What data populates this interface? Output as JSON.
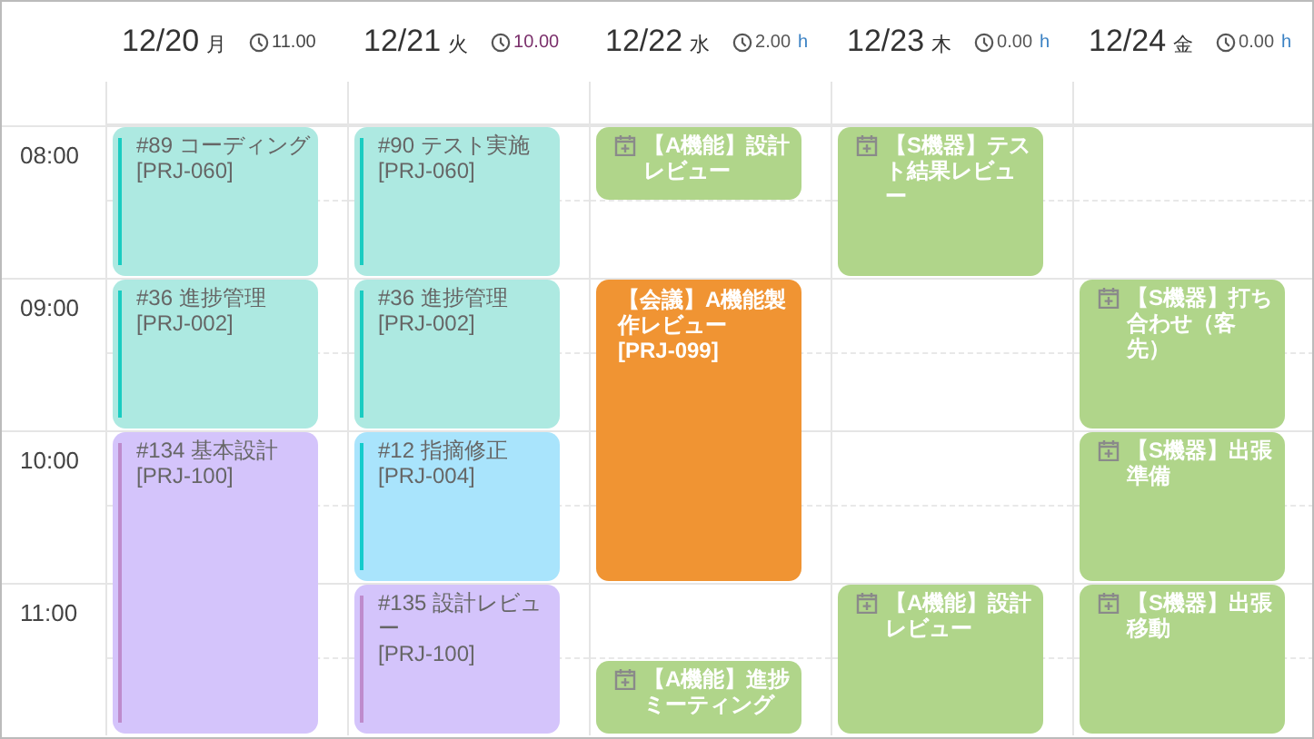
{
  "days": [
    {
      "date": "12/20",
      "weekday": "月",
      "total": "11.00",
      "color": "#444444",
      "blocks": [
        {
          "kind": "task",
          "half": false,
          "double": false,
          "color": "#ade9e1",
          "title": "#89 コーディング",
          "code": "[PRJ-060]"
        },
        {
          "kind": "task",
          "half": false,
          "double": false,
          "color": "#ade9e1",
          "title": "#36 進捗管理",
          "code": "[PRJ-002]"
        },
        {
          "kind": "task",
          "half": false,
          "double": true,
          "color": "#d4c4fb",
          "title": "#134 基本設計",
          "code": "[PRJ-100]"
        }
      ]
    },
    {
      "date": "12/21",
      "weekday": "火",
      "total": "10.00",
      "color": "#7a2e6a",
      "blocks": [
        {
          "kind": "task",
          "half": false,
          "double": false,
          "color": "#ade9e1",
          "title": "#90 テスト実施",
          "code": "[PRJ-060]"
        },
        {
          "kind": "task",
          "half": false,
          "double": false,
          "color": "#ade9e1",
          "title": "#36 進捗管理",
          "code": "[PRJ-002]"
        },
        {
          "kind": "task",
          "half": false,
          "double": false,
          "color": "#a9e4fc",
          "title": "#12 指摘修正",
          "code": "[PRJ-004]"
        },
        {
          "kind": "task",
          "half": false,
          "double": false,
          "color": "#d4c4fb",
          "title": "#135 設計レビュー",
          "code": "[PRJ-100]"
        }
      ]
    },
    {
      "date": "12/22",
      "weekday": "水",
      "total": "2.00",
      "unit": "h",
      "color": "#555555",
      "blocks": [
        {
          "kind": "schedule",
          "half": true,
          "double": false,
          "color": "#b0d58a",
          "title": "【A機能】設計レビュー"
        },
        {
          "kind": "gap",
          "half": true,
          "double": false
        },
        {
          "kind": "conference",
          "half": false,
          "double": true,
          "color": "#f09433",
          "title": "【会議】A機能製作レビュー",
          "code": "[PRJ-099]"
        },
        {
          "kind": "gap",
          "half": true,
          "double": false
        },
        {
          "kind": "schedule",
          "half": true,
          "double": false,
          "color": "#b0d58a",
          "title": "【A機能】進捗ミーティング"
        }
      ]
    },
    {
      "date": "12/23",
      "weekday": "木",
      "total": "0.00",
      "unit": "h",
      "color": "#555555",
      "blocks": [
        {
          "kind": "schedule",
          "half": false,
          "double": false,
          "color": "#b0d58a",
          "title": "【S機器】テスト結果レビュー"
        },
        {
          "kind": "gap",
          "half": false,
          "double": true
        },
        {
          "kind": "schedule",
          "half": false,
          "double": false,
          "color": "#b0d58a",
          "title": "【A機能】設計レビュー"
        }
      ]
    },
    {
      "date": "12/24",
      "weekday": "金",
      "total": "0.00",
      "unit": "h",
      "color": "#555555",
      "blocks": [
        {
          "kind": "gap",
          "half": false,
          "double": false
        },
        {
          "kind": "schedule",
          "half": false,
          "double": false,
          "color": "#b0d58a",
          "title": "【S機器】打ち合わせ（客先）"
        },
        {
          "kind": "schedule",
          "half": false,
          "double": false,
          "color": "#b0d58a",
          "title": "【S機器】出張準備"
        },
        {
          "kind": "schedule",
          "half": false,
          "double": false,
          "color": "#b0d58a",
          "title": "【S機器】出張移動"
        }
      ]
    }
  ],
  "hours": [
    "08:00",
    "09:00",
    "10:00",
    "11:00"
  ]
}
